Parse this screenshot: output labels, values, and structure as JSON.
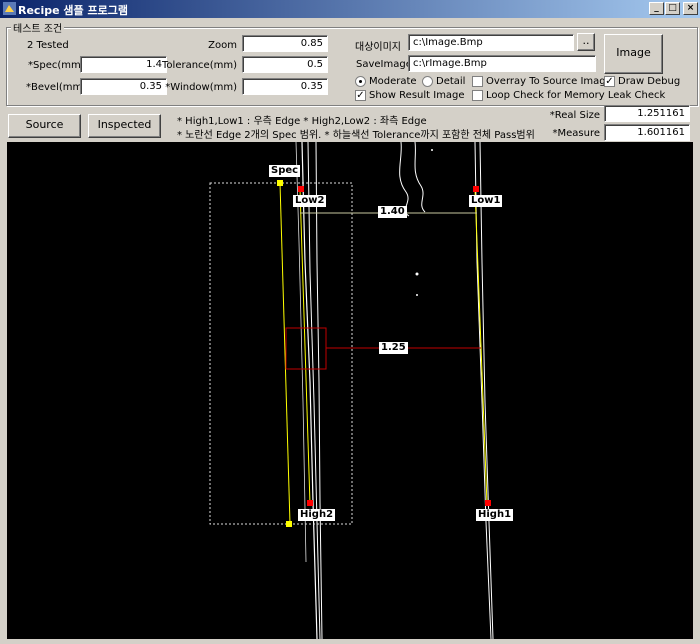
{
  "window": {
    "title": "Recipe 샘플 프로그램",
    "min": "_",
    "max": "□",
    "close": "×"
  },
  "group": {
    "title": "테스트 조건",
    "tested": "2 Tested"
  },
  "fields": {
    "zoom_label": "Zoom",
    "zoom": "0.85",
    "spec_label": "*Spec(mm)",
    "spec": "1.4",
    "tolerance_label": "Tolerance(mm)",
    "tolerance": "0.5",
    "bevel_label": "*Bevel(mm)",
    "bevel": "0.35",
    "window_label": "*Window(mm)",
    "window": "0.35"
  },
  "files": {
    "target_label": "대상이미지",
    "target": "c:\\Image.Bmp",
    "browse": "..",
    "save_label": "SaveImage",
    "save": "c:\\rImage.Bmp",
    "image_button": "Image"
  },
  "options": {
    "moderate": "Moderate",
    "moderate_on": true,
    "detail": "Detail",
    "detail_on": false,
    "overlay": "Overray To Source Image",
    "overlay_on": false,
    "draw_debug": "Draw Debug",
    "draw_debug_on": true,
    "show_result": "Show Result Image",
    "show_result_on": true,
    "loop_check": "Loop Check for Memory Leak Check",
    "loop_check_on": false
  },
  "buttons": {
    "source": "Source",
    "inspected": "Inspected"
  },
  "notes": {
    "line1": "* High1,Low1 : 우측 Edge    * High2,Low2 : 좌측 Edge",
    "line2": "* 노란선 Edge 2개의 Spec 범위. * 하늘색선 Tolerance까지 포함한 전체 Pass범위"
  },
  "results": {
    "real_size_label": "*Real Size",
    "real_size": "1.251161",
    "measure_label": "*Measure",
    "measure": "1.601161"
  },
  "overlay": {
    "spec": "Spec",
    "low2": "Low2",
    "low1": "Low1",
    "high2": "High2",
    "high1": "High1",
    "dist_top": "1.40",
    "dist_mid": "1.25"
  }
}
